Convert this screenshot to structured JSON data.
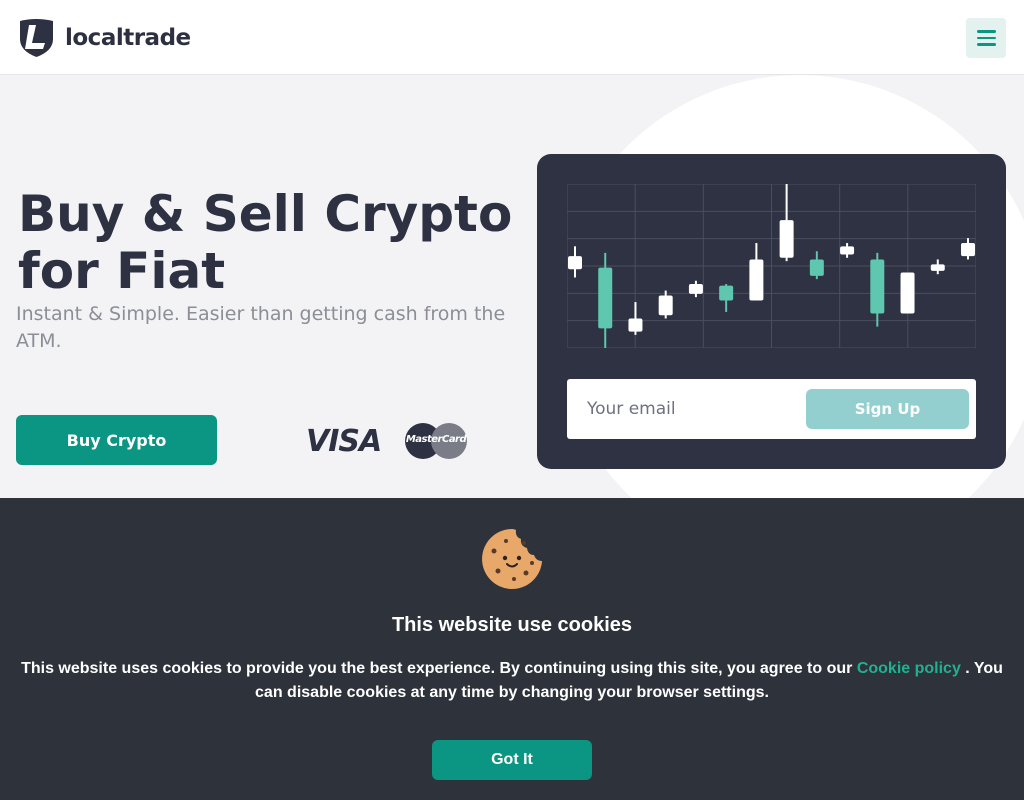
{
  "header": {
    "logo_text": "localtrade",
    "menu_icon": "hamburger-menu-icon"
  },
  "hero": {
    "title_line1": "Buy & Sell Crypto",
    "title_line2": "for Fiat",
    "subtitle": "Instant & Simple. Easier than getting cash from the ATM.",
    "buy_button": "Buy Crypto",
    "payment_visa": "VISA",
    "payment_mastercard": "MasterCard"
  },
  "signup": {
    "email_placeholder": "Your email",
    "email_value": "",
    "button": "Sign Up"
  },
  "cookie_banner": {
    "icon": "cookie-icon",
    "title": "This website use cookies",
    "text_before_link": "This website uses cookies to provide you the best experience. By continuing using this site, you agree to our ",
    "link_text": "Cookie policy",
    "text_after_link": " . You can disable cookies at any time by changing your browser settings.",
    "button": "Got It"
  },
  "colors": {
    "accent": "#0a9682",
    "candle_up": "#ffffff",
    "candle_down": "#5fc6b0",
    "card_bg": "#2f3242",
    "cookie_bg": "#2e323b",
    "link": "#1fb28f"
  },
  "chart_data": {
    "type": "candlestick",
    "grid": true,
    "candles": [
      {
        "open": 0.56,
        "close": 0.48,
        "high": 0.62,
        "low": 0.43,
        "color": "white"
      },
      {
        "open": 0.49,
        "close": 0.12,
        "high": 0.58,
        "low": 0.0,
        "color": "green"
      },
      {
        "open": 0.1,
        "close": 0.18,
        "high": 0.28,
        "low": 0.08,
        "color": "white"
      },
      {
        "open": 0.2,
        "close": 0.32,
        "high": 0.35,
        "low": 0.18,
        "color": "white"
      },
      {
        "open": 0.33,
        "close": 0.39,
        "high": 0.41,
        "low": 0.31,
        "color": "white"
      },
      {
        "open": 0.38,
        "close": 0.29,
        "high": 0.39,
        "low": 0.22,
        "color": "green"
      },
      {
        "open": 0.29,
        "close": 0.54,
        "high": 0.64,
        "low": 0.29,
        "color": "white"
      },
      {
        "open": 0.55,
        "close": 0.78,
        "high": 1.0,
        "low": 0.53,
        "color": "white"
      },
      {
        "open": 0.54,
        "close": 0.44,
        "high": 0.59,
        "low": 0.42,
        "color": "green"
      },
      {
        "open": 0.57,
        "close": 0.62,
        "high": 0.64,
        "low": 0.55,
        "color": "white"
      },
      {
        "open": 0.54,
        "close": 0.21,
        "high": 0.58,
        "low": 0.13,
        "color": "green"
      },
      {
        "open": 0.21,
        "close": 0.46,
        "high": 0.46,
        "low": 0.21,
        "color": "white"
      },
      {
        "open": 0.47,
        "close": 0.51,
        "high": 0.54,
        "low": 0.45,
        "color": "white"
      },
      {
        "open": 0.56,
        "close": 0.64,
        "high": 0.67,
        "low": 0.54,
        "color": "white"
      }
    ]
  }
}
